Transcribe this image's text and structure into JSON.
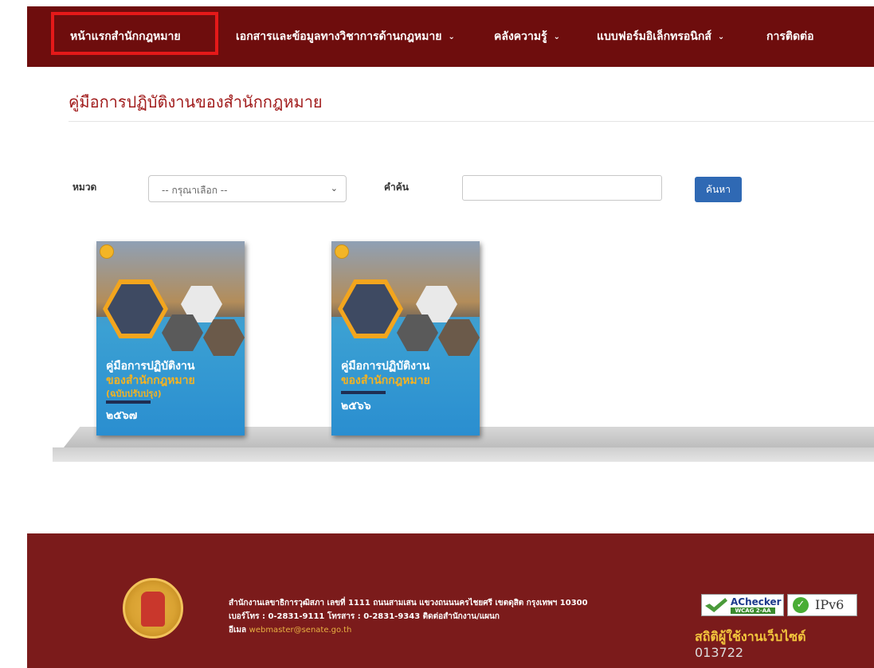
{
  "nav": {
    "items": [
      {
        "label": "หน้าแรกสำนักกฎหมาย",
        "dropdown": false
      },
      {
        "label": "เอกสารและข้อมูลทางวิชาการด้านกฎหมาย",
        "dropdown": true
      },
      {
        "label": "คลังความรู้",
        "dropdown": true
      },
      {
        "label": "แบบฟอร์มอิเล็กทรอนิกส์",
        "dropdown": true
      },
      {
        "label": "การติดต่อ",
        "dropdown": false
      }
    ],
    "caret": "⌄"
  },
  "page": {
    "title": "คู่มือการปฏิบัติงานของสำนักกฎหมาย"
  },
  "search": {
    "category_label": "หมวด",
    "category_selected": "-- กรุณาเลือก --",
    "keyword_label": "คำค้น",
    "keyword_value": "",
    "button_label": "ค้นหา"
  },
  "books": [
    {
      "line1": "คู่มือการปฏิบัติงาน",
      "line2": "ของสำนักกฎหมาย",
      "line3": "(ฉบับปรับปรุง)",
      "year": "๒๕๖๗"
    },
    {
      "line1": "คู่มือการปฏิบัติงาน",
      "line2": "ของสำนักกฎหมาย",
      "year": "๒๕๖๖"
    }
  ],
  "footer": {
    "address": "สำนักงานเลขาธิการวุฒิสภา เลขที่ 1111 ถนนสามเสน แขวงถนนนครไชยศรี เขตดุสิต กรุงเทพฯ 10300",
    "phone": "เบอร์โทร : 0-2831-9111 โทรสาร : 0-2831-9343 ติดต่อสำนักงาน/แผนก",
    "email_label": "อีเมล",
    "email": "webmaster@senate.go.th",
    "achecker": "AChecker",
    "wcag": "WCAG 2-AA",
    "ipv6": "IPv6",
    "stat_label": "สถิติผู้ใช้งานเว็บไซต์",
    "stat_value": "013722"
  },
  "colors": {
    "nav_bg": "#6e0d0d",
    "footer_bg": "#7b1b1b",
    "title": "#a11c1c",
    "button": "#2f69b4",
    "highlight": "#e51919"
  }
}
